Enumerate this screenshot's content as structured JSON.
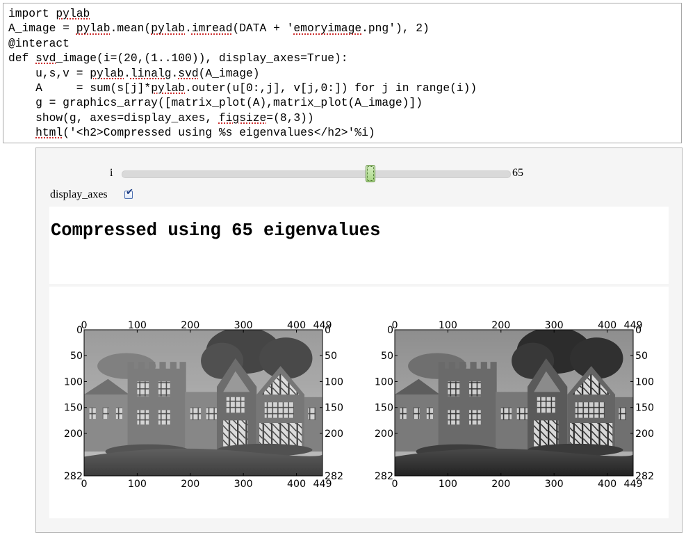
{
  "code": {
    "lines": [
      [
        {
          "t": "import "
        },
        {
          "t": "pylab",
          "u": true
        }
      ],
      [
        {
          "t": "A_image = "
        },
        {
          "t": "pylab",
          "u": true
        },
        {
          "t": ".mean("
        },
        {
          "t": "pylab",
          "u": true
        },
        {
          "t": "."
        },
        {
          "t": "imread",
          "u": true
        },
        {
          "t": "(DATA + '"
        },
        {
          "t": "emoryimage",
          "u": true
        },
        {
          "t": ".png'), 2)"
        }
      ],
      [
        {
          "t": "@interact"
        }
      ],
      [
        {
          "t": "def "
        },
        {
          "t": "svd",
          "u": true
        },
        {
          "t": "_image(i=(20,(1..100)), display_axes=True):"
        }
      ],
      [
        {
          "t": "    u,s,v = "
        },
        {
          "t": "pylab",
          "u": true
        },
        {
          "t": "."
        },
        {
          "t": "linalg",
          "u": true
        },
        {
          "t": "."
        },
        {
          "t": "svd",
          "u": true
        },
        {
          "t": "(A_image)"
        }
      ],
      [
        {
          "t": "    A     = sum(s[j]*"
        },
        {
          "t": "pylab",
          "u": true
        },
        {
          "t": ".outer(u[0:,j], v[j,0:]) for j in range(i))"
        }
      ],
      [
        {
          "t": "    g = graphics_array([matrix_plot(A),matrix_plot(A_image)])"
        }
      ],
      [
        {
          "t": "    show(g, axes=display_axes, "
        },
        {
          "t": "figsize",
          "u": true
        },
        {
          "t": "=(8,3))"
        }
      ],
      [
        {
          "t": "    "
        },
        {
          "t": "html",
          "u": true
        },
        {
          "t": "('<h2>Compressed using %s eigenvalues</h2>'%i)"
        }
      ]
    ]
  },
  "interact": {
    "slider": {
      "label": "i",
      "value": "65",
      "min": 1,
      "max": 100,
      "current": 65
    },
    "display_axes": {
      "label": "display_axes",
      "checked": true,
      "checkmark": "✔"
    },
    "heading": "Compressed using 65 eigenvalues"
  },
  "plots": {
    "x_ticks": [
      "0",
      "100",
      "200",
      "300",
      "400",
      "449"
    ],
    "y_ticks": [
      "0",
      "50",
      "100",
      "150",
      "200",
      "282"
    ],
    "x_values": [
      0,
      100,
      200,
      300,
      400,
      449
    ],
    "y_values": [
      0,
      50,
      100,
      150,
      200,
      282
    ],
    "x_max": 449,
    "y_max": 282,
    "panels": [
      "compressed-image",
      "original-image"
    ]
  }
}
